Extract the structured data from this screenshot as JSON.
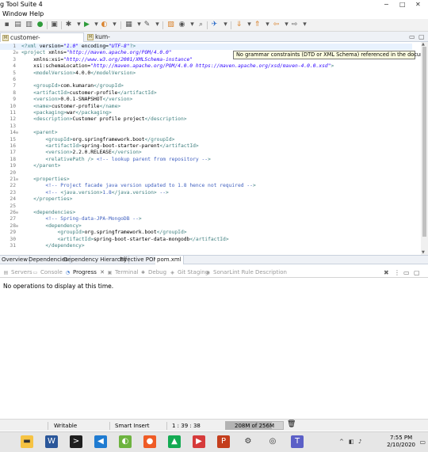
{
  "window": {
    "title": "g Tool Suite 4",
    "controls": [
      "−",
      "□",
      "✕"
    ]
  },
  "menu": [
    "Window",
    "Help"
  ],
  "toolbar": {
    "icons": [
      "save-icon",
      "print-icon",
      "check-icon",
      "debug-icon",
      "run-icon",
      "run-arrow-icon",
      "external-tools-icon",
      "new-icon",
      "search-icon",
      "browser-icon",
      "open-type-icon",
      "task-icon",
      "back-icon",
      "forward-icon",
      "last-edit-icon",
      "next-icon"
    ]
  },
  "editor_tabs": [
    {
      "label": "customer-profile/pom.xml",
      "active": true,
      "close": "✕"
    },
    {
      "label": "kum-assmt/pom.xml",
      "active": false,
      "close": ""
    }
  ],
  "editor_controls": [
    "▭",
    "▢"
  ],
  "tooltip": "No grammar constraints (DTD or XML Schema) referenced in the document.",
  "code": {
    "current_line": "1",
    "lines": [
      {
        "n": "1",
        "fold": "",
        "text": "<?xml version=\"1.0\" encoding=\"UTF-8\"?>"
      },
      {
        "n": "2",
        "fold": "⊖",
        "text": "<project xmlns=\"http://maven.apache.org/POM/4.0.0\""
      },
      {
        "n": "3",
        "fold": "",
        "text": "    xmlns:xsi=\"http://www.w3.org/2001/XMLSchema-instance\""
      },
      {
        "n": "4",
        "fold": "",
        "text": "    xsi:schemaLocation=\"http://maven.apache.org/POM/4.0.0 https://maven.apache.org/xsd/maven-4.0.0.xsd\">"
      },
      {
        "n": "5",
        "fold": "",
        "text": "    <modelVersion>4.0.0</modelVersion>"
      },
      {
        "n": "6",
        "fold": "",
        "text": ""
      },
      {
        "n": "7",
        "fold": "",
        "text": "    <groupId>com.kumaran</groupId>"
      },
      {
        "n": "8",
        "fold": "",
        "text": "    <artifactId>customer-profile</artifactId>"
      },
      {
        "n": "9",
        "fold": "",
        "text": "    <version>0.0.1-SNAPSHOT</version>"
      },
      {
        "n": "10",
        "fold": "",
        "text": "    <name>customer-profile</name>"
      },
      {
        "n": "11",
        "fold": "",
        "text": "    <packaging>war</packaging>"
      },
      {
        "n": "12",
        "fold": "",
        "text": "    <description>Customer profile project</description>"
      },
      {
        "n": "13",
        "fold": "",
        "text": ""
      },
      {
        "n": "14",
        "fold": "⊖",
        "text": "    <parent>"
      },
      {
        "n": "15",
        "fold": "",
        "text": "        <groupId>org.springframework.boot</groupId>"
      },
      {
        "n": "16",
        "fold": "",
        "text": "        <artifactId>spring-boot-starter-parent</artifactId>"
      },
      {
        "n": "17",
        "fold": "",
        "text": "        <version>2.2.0.RELEASE</version>"
      },
      {
        "n": "18",
        "fold": "",
        "text": "        <relativePath /> <!-- lookup parent from repository -->"
      },
      {
        "n": "19",
        "fold": "",
        "text": "    </parent>"
      },
      {
        "n": "20",
        "fold": "",
        "text": ""
      },
      {
        "n": "21",
        "fold": "⊖",
        "text": "    <properties>"
      },
      {
        "n": "22",
        "fold": "",
        "text": "        <!-- Project facade java version updated to 1.8 hence not required -->"
      },
      {
        "n": "23",
        "fold": "",
        "text": "        <!-- <java.version>1.8</java.version> -->"
      },
      {
        "n": "24",
        "fold": "",
        "text": "    </properties>"
      },
      {
        "n": "25",
        "fold": "",
        "text": ""
      },
      {
        "n": "26",
        "fold": "⊖",
        "text": "    <dependencies>"
      },
      {
        "n": "27",
        "fold": "",
        "text": "        <!-- Spring-data-JPA-MongoDB -->"
      },
      {
        "n": "28",
        "fold": "⊖",
        "text": "        <dependency>"
      },
      {
        "n": "29",
        "fold": "",
        "text": "            <groupId>org.springframework.boot</groupId>"
      },
      {
        "n": "30",
        "fold": "",
        "text": "            <artifactId>spring-boot-starter-data-mongodb</artifactId>"
      },
      {
        "n": "31",
        "fold": "",
        "text": "        </dependency>"
      }
    ]
  },
  "pom_tabs": [
    {
      "label": "Overview",
      "active": false
    },
    {
      "label": "Dependencies",
      "active": false
    },
    {
      "label": "Dependency Hierarchy",
      "active": false
    },
    {
      "label": "Effective POM",
      "active": false
    },
    {
      "label": "pom.xml",
      "active": true
    }
  ],
  "views": [
    {
      "label": "Servers",
      "icon": "servers-icon",
      "glyph": "▤",
      "active": false
    },
    {
      "label": "Console",
      "icon": "console-icon",
      "glyph": "▭",
      "active": false
    },
    {
      "label": "Progress",
      "icon": "progress-icon",
      "glyph": "◔",
      "active": true,
      "close": "✕"
    },
    {
      "label": "Terminal",
      "icon": "terminal-icon",
      "glyph": "▣",
      "active": false
    },
    {
      "label": "Debug",
      "icon": "debug-icon",
      "glyph": "✱",
      "active": false
    },
    {
      "label": "Git Staging",
      "icon": "git-staging-icon",
      "glyph": "◈",
      "active": false
    },
    {
      "label": "SonarLint Rule Description",
      "icon": "sonarlint-icon",
      "glyph": "◉",
      "active": false
    }
  ],
  "view_controls": [
    "✖",
    "⋮",
    "▭",
    "▢"
  ],
  "view_message": "No operations to display at this time.",
  "status": {
    "mode": "Writable",
    "insert": "Smart Insert",
    "position": "1 : 39 : 38",
    "heap": "208M of 256M",
    "heap_used_fraction": 0.81
  },
  "taskbar": {
    "apps": [
      {
        "name": "file-explorer-icon",
        "glyph": "▬",
        "bg": "#f6c343"
      },
      {
        "name": "word-icon",
        "glyph": "W",
        "bg": "#2b579a"
      },
      {
        "name": "terminal-icon",
        "glyph": ">",
        "bg": "#1e1e1e"
      },
      {
        "name": "vscode-icon",
        "glyph": "◀",
        "bg": "#1f7bd1"
      },
      {
        "name": "spring-tools-icon",
        "glyph": "◐",
        "bg": "#6db33f"
      },
      {
        "name": "postman-icon",
        "glyph": "●",
        "bg": "#ef5b25"
      },
      {
        "name": "mongodb-icon",
        "glyph": "▲",
        "bg": "#13aa52"
      },
      {
        "name": "media-icon",
        "glyph": "▶",
        "bg": "#d63a3a"
      },
      {
        "name": "powerpoint-icon",
        "glyph": "P",
        "bg": "#c43e1c"
      },
      {
        "name": "settings-icon",
        "glyph": "⚙",
        "bg": "#e6e6e6"
      },
      {
        "name": "chrome-icon",
        "glyph": "◎",
        "bg": "#e6e6e6"
      },
      {
        "name": "teams-icon",
        "glyph": "T",
        "bg": "#5b5fc7"
      }
    ],
    "time": "7:55 PM",
    "date": "2/10/2020"
  }
}
